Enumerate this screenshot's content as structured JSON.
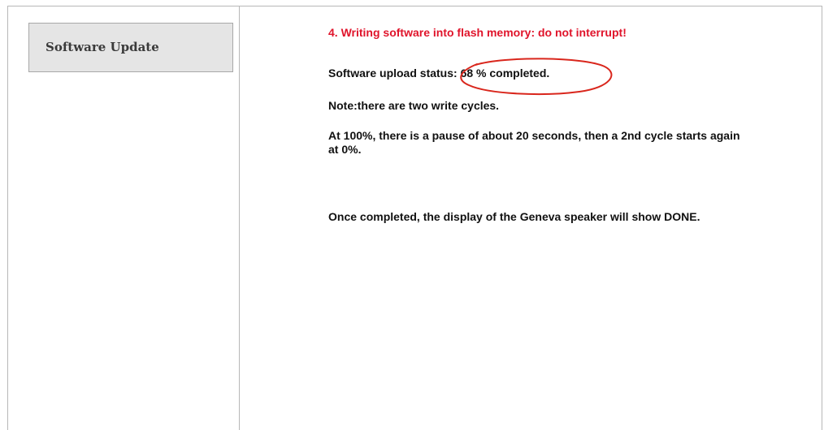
{
  "sidebar": {
    "items": [
      {
        "label": "Software Update"
      }
    ]
  },
  "main": {
    "step_title": "4. Writing software into flash memory: do not interrupt!",
    "status_text": "Software upload status: 68 % completed.",
    "progress_percent": 68,
    "note_text": "Note:there are two write cycles.",
    "pause_text": "At 100%, there is a pause of about 20 seconds, then a 2nd cycle starts again at 0%.",
    "done_text": "Once completed, the display of the Geneva speaker will show DONE."
  },
  "colors": {
    "warning": "#e0142b",
    "annotation": "#d9261c",
    "nav_background": "#e5e5e5",
    "border": "#b8b8b8"
  }
}
